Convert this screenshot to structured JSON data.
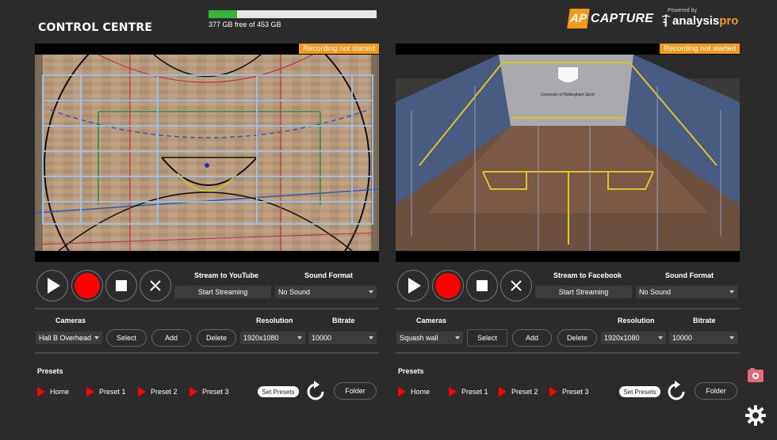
{
  "app": {
    "title": "CONTROL CENTRE",
    "disk": {
      "text": "377 GB free of 453 GB",
      "used_fraction": 0.17
    },
    "logo_capture": {
      "ap": "AP",
      "capture": "CAPTURE"
    },
    "logo_analysis": {
      "powered_by": "Powered by",
      "analysis": "analysis",
      "pro": "pro"
    }
  },
  "colors": {
    "accent": "#f39a1d",
    "record": "#ff0000",
    "disk_fill": "#35b43b"
  },
  "panels": [
    {
      "recording_status": "Recording not started",
      "stream_label": "Stream to YouTube",
      "start_streaming": "Start Streaming",
      "sound_format_label": "Sound Format",
      "sound_format_value": "No Sound",
      "cameras_label": "Cameras",
      "camera_value": "Hall B Overhead",
      "select_label": "Select",
      "add_label": "Add",
      "delete_label": "Delete",
      "resolution_label": "Resolution",
      "resolution_value": "1920x1080",
      "bitrate_label": "Bitrate",
      "bitrate_value": "10000",
      "presets_label": "Presets",
      "presets": [
        "Home",
        "Preset 1",
        "Preset 2",
        "Preset 3"
      ],
      "set_presets_label": "Set Presets",
      "folder_label": "Folder"
    },
    {
      "recording_status": "Recording not started",
      "stream_label": "Stream to Facebook",
      "start_streaming": "Start Streaming",
      "sound_format_label": "Sound Format",
      "sound_format_value": "No Sound",
      "cameras_label": "Cameras",
      "camera_value": "Squash wall",
      "select_label": "Select",
      "add_label": "Add",
      "delete_label": "Delete",
      "resolution_label": "Resolution",
      "resolution_value": "1920x1080",
      "bitrate_label": "Bitrate",
      "bitrate_value": "10000",
      "presets_label": "Presets",
      "presets": [
        "Home",
        "Preset 1",
        "Preset 2",
        "Preset 3"
      ],
      "set_presets_label": "Set Presets",
      "folder_label": "Folder"
    }
  ],
  "icons": [
    "play-icon",
    "record-icon",
    "stop-icon",
    "close-icon",
    "reload-icon",
    "photo-icon",
    "gear-icon",
    "dropdown-arrow-icon",
    "preset-arrow-icon"
  ],
  "scene_text": {
    "squash_sign": "University of Nottingham Sport"
  }
}
